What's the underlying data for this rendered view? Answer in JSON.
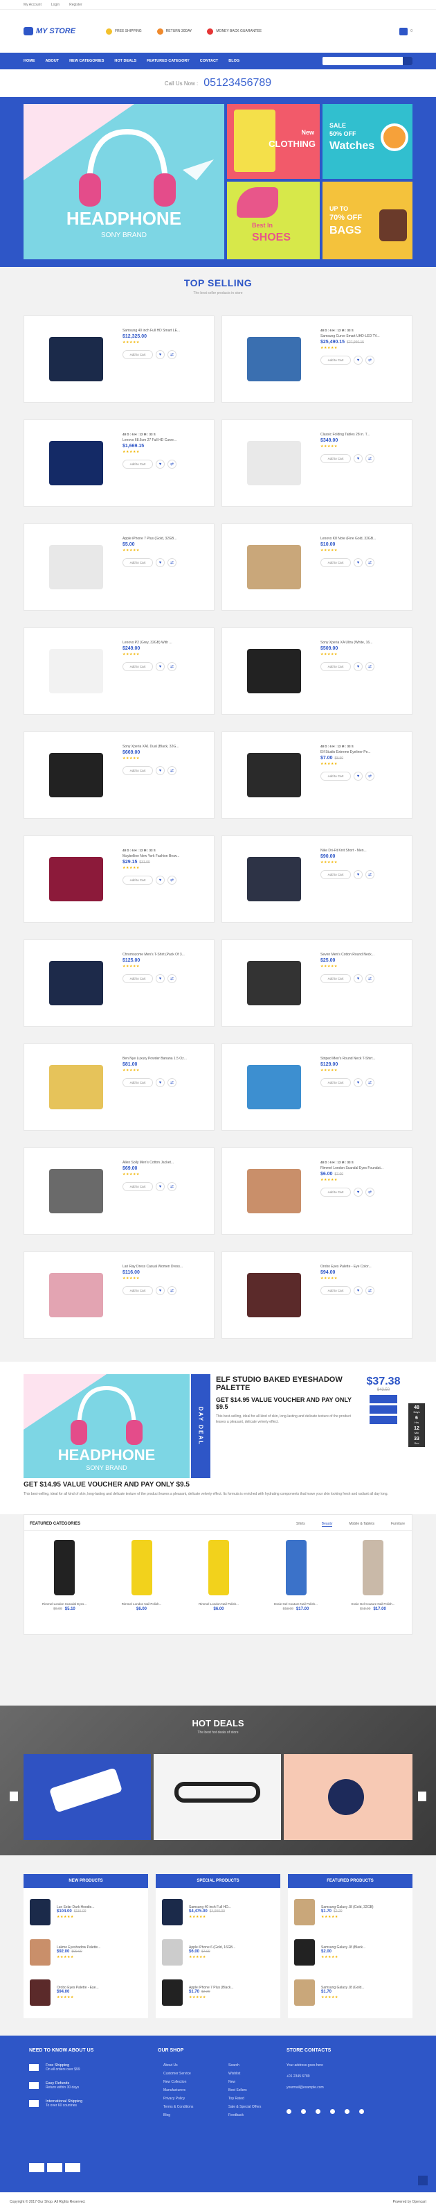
{
  "topbar": {
    "links": [
      "My Account",
      "Login",
      "Register"
    ]
  },
  "header": {
    "logo": "MY STORE",
    "features": [
      {
        "label": "FREE SHIPPING",
        "color": "#f3c12c"
      },
      {
        "label": "RETURN 30DAY",
        "color": "#f08a2c"
      },
      {
        "label": "MONEY BACK GUARANTEE",
        "color": "#e53535"
      }
    ],
    "cart_count": "0"
  },
  "nav": {
    "items": [
      "HOME",
      "ABOUT",
      "NEW CATEGORIES",
      "HOT DEALS",
      "FEATURED CATEGORY",
      "CONTACT",
      "BLOG"
    ],
    "search_placeholder": "Search entire store here..."
  },
  "callbar": {
    "label": "Call Us Now :",
    "number": "05123456789"
  },
  "hero": {
    "main_title": "HEADPHONE",
    "main_sub": "SONY BRAND",
    "tiles": [
      {
        "line1": "New",
        "line2": "CLOTHING"
      },
      {
        "line1": "SALE",
        "line2": "50% OFF",
        "line3": "Watches"
      },
      {
        "line1": "Best In",
        "line2": "SHOES"
      },
      {
        "line1": "UP TO",
        "line2": "70% OFF",
        "line3": "BAGS"
      }
    ]
  },
  "top_selling": {
    "title": "TOP SELLING",
    "subtitle": "The best seller products in store",
    "add_label": "Add to Cart",
    "products": [
      {
        "name": "Samsung 40 inch Full HD Smart LE...",
        "price": "$12,325.00",
        "old": "",
        "timer": "",
        "thumb": "tv-dark",
        "color": "#1b2a4a"
      },
      {
        "name": "Samsung Curve Smart UHD-LED TV...",
        "price": "$25,490.15",
        "old": "$27,990.15",
        "timer": "48 D : 6 H : 12 M : 33 S",
        "thumb": "tv-curve",
        "color": "#3a6fb0"
      },
      {
        "name": "Lenovo 68.6cm 27 Full HD Curve...",
        "price": "$1,669.15",
        "old": "",
        "timer": "48 D : 6 H : 12 M : 33 S",
        "thumb": "monitor",
        "color": "#142a66"
      },
      {
        "name": "Classic Folding Tables 28 in. T...",
        "price": "$349.00",
        "old": "",
        "timer": "",
        "thumb": "table",
        "color": "#e9e9e9"
      },
      {
        "name": "Apple iPhone 7 Plus (Gold, 32GB...",
        "price": "$5.00",
        "old": "",
        "timer": "",
        "thumb": "iphone",
        "color": "#e8e8e8"
      },
      {
        "name": "Lenovo K8 Note (Fine Gold, 32GB...",
        "price": "$10.00",
        "old": "",
        "timer": "",
        "thumb": "phone-gold",
        "color": "#c9a77a"
      },
      {
        "name": "Lenovo P2 (Grey, 32GB) With ...",
        "price": "$249.00",
        "old": "",
        "timer": "",
        "thumb": "phone-white",
        "color": "#f2f2f2"
      },
      {
        "name": "Sony Xperia XA Ultra (White, 16...",
        "price": "$509.00",
        "old": "",
        "timer": "",
        "thumb": "phone-black",
        "color": "#222"
      },
      {
        "name": "Sony Xperia XA1 Dual (Black, 32G...",
        "price": "$669.00",
        "old": "",
        "timer": "",
        "thumb": "phone-black2",
        "color": "#222"
      },
      {
        "name": "Elf Studio Extreme Eyeliner Pe...",
        "price": "$7.00",
        "old": "$8.50",
        "timer": "48 D : 6 H : 12 M : 33 S",
        "thumb": "pencil",
        "color": "#2a2a2a"
      },
      {
        "name": "Maybelline New York Fashion Brow...",
        "price": "$29.15",
        "old": "$31.00",
        "timer": "48 D : 6 H : 12 M : 33 S",
        "thumb": "mascara",
        "color": "#8c1a3a"
      },
      {
        "name": "Nike Dri-Fit Knit Short - Men...",
        "price": "$90.00",
        "old": "",
        "timer": "",
        "thumb": "shorts",
        "color": "#2d3346"
      },
      {
        "name": "Chromozome Men's T-Shirt (Pack Of 3...",
        "price": "$125.00",
        "old": "",
        "timer": "",
        "thumb": "tshirts",
        "color": "#1d2a4a"
      },
      {
        "name": "Seven Men's Cotton Round Neck...",
        "price": "$25.00",
        "old": "",
        "timer": "",
        "thumb": "tee",
        "color": "#333"
      },
      {
        "name": "Ben Nye Luxury Powder Banana 1.5 Oz...",
        "price": "$81.00",
        "old": "",
        "timer": "",
        "thumb": "powder",
        "color": "#e6c35a"
      },
      {
        "name": "Striped Men's Round Neck T-Shirt...",
        "price": "$129.00",
        "old": "",
        "timer": "",
        "thumb": "striped",
        "color": "#3d8fd0"
      },
      {
        "name": "Allen Solly Men's Cotton Jacket...",
        "price": "$69.00",
        "old": "",
        "timer": "",
        "thumb": "man",
        "color": "#6a6a6a"
      },
      {
        "name": "Rimmel London Scandal Eyes Foundat...",
        "price": "$6.00",
        "old": "$7.00",
        "timer": "48 D : 6 H : 12 M : 33 S",
        "thumb": "foundation",
        "color": "#c98f6a"
      },
      {
        "name": "Lari Ray Dress Casual Women Dress...",
        "price": "$116.00",
        "old": "",
        "timer": "",
        "thumb": "dress",
        "color": "#e3a4b2"
      },
      {
        "name": "Orobo Eyes Palette - Eye Color...",
        "price": "$94.00",
        "old": "",
        "timer": "",
        "thumb": "palette",
        "color": "#5b2a2a"
      }
    ]
  },
  "deal": {
    "banner_title": "HEADPHONE",
    "banner_sub": "SONY BRAND",
    "tag": "DAY DEAL",
    "title": "ELF STUDIO BAKED EYESHADOW PALETTE",
    "subtitle": "GET $14.95 VALUE VOUCHER AND PAY ONLY $9.5",
    "desc": "This best-selling, ideal for all kind of skin, long-lasting and delicate texture of the product leaves a pleasant, delicate velvety effect.",
    "headline": "GET $14.95 VALUE VOUCHER AND PAY ONLY $9.5",
    "paragraph": "This best-selling, ideal for all kind of skin, long-lasting and delicate texture of the product leaves a pleasant, delicate velvety effect. Its formula is enriched with hydrating components that leave your skin looking fresh and radiant all day long.",
    "price": "$37.38",
    "old": "$42.50",
    "count": [
      {
        "v": "48",
        "u": "Days"
      },
      {
        "v": "6",
        "u": "Hrs"
      },
      {
        "v": "12",
        "u": "Min"
      },
      {
        "v": "33",
        "u": "Sec"
      }
    ]
  },
  "featured": {
    "title": "FEATURED CATEGORIES",
    "tabs": [
      "Shirts",
      "Beauty",
      "Mobile & Tablets",
      "Furniture"
    ],
    "items": [
      {
        "name": "Rimmel London Scandal Eyes...",
        "price": "$5.10",
        "old": "$6.00",
        "color": "#222"
      },
      {
        "name": "Rimmel London Nail Polish...",
        "price": "$6.00",
        "old": "",
        "color": "#f2d21c"
      },
      {
        "name": "Rimmel London Nail Polish...",
        "price": "$6.00",
        "old": "",
        "color": "#f2d21c"
      },
      {
        "name": "Essie Gel Couture Nail Polish...",
        "price": "$17.00",
        "old": "$18.00",
        "color": "#3b72c9"
      },
      {
        "name": "Essie Gel Couture Nail Polish...",
        "price": "$17.00",
        "old": "$18.00",
        "color": "#c9b9a8"
      }
    ]
  },
  "hot": {
    "title": "HOT DEALS",
    "subtitle": "The best hot deals of store"
  },
  "lists": [
    {
      "title": "NEW PRODUCTS",
      "items": [
        {
          "name": "Lux Solar Dark Hoodie...",
          "price": "$104.00",
          "old": "$115.00",
          "color": "#1b2a4a"
        },
        {
          "name": "Lakme Eyeshadow Palette...",
          "price": "$92.00",
          "old": "$99.00",
          "color": "#c98f6a"
        },
        {
          "name": "Orobo Eyes Palette - Eye...",
          "price": "$94.00",
          "old": "",
          "color": "#5b2a2a"
        }
      ]
    },
    {
      "title": "SPECIAL PRODUCTS",
      "items": [
        {
          "name": "Samsung 40 inch Full HD...",
          "price": "$4,475.00",
          "old": "$4,990.00",
          "color": "#1b2a4a"
        },
        {
          "name": "Apple iPhone 6 (Gold, 16GB...",
          "price": "$6.00",
          "old": "$7.00",
          "color": "#ccc"
        },
        {
          "name": "Apple iPhone 7 Plus (Black...",
          "price": "$1.70",
          "old": "$2.20",
          "color": "#222"
        }
      ]
    },
    {
      "title": "FEATURED PRODUCTS",
      "items": [
        {
          "name": "Samsung Galaxy J8 (Gold, 32GB)",
          "price": "$1.70",
          "old": "$2.20",
          "color": "#c9a77a"
        },
        {
          "name": "Samsung Galaxy J8 (Black...",
          "price": "$2.00",
          "old": "",
          "color": "#222"
        },
        {
          "name": "Samsung Galaxy J8 (Gold...",
          "price": "$1.70",
          "old": "",
          "color": "#c9a77a"
        }
      ]
    }
  ],
  "footer": {
    "col1": {
      "title": "NEED TO KNOW ABOUT US",
      "items": [
        {
          "t": "Free Shipping",
          "s": "On all orders over $99"
        },
        {
          "t": "Easy Refunds",
          "s": "Return within 30 days"
        },
        {
          "t": "International Shipping",
          "s": "To over 60 countries"
        }
      ]
    },
    "col2": {
      "title": "OUR SHOP",
      "left": [
        "About Us",
        "Customer Service",
        "New Collection",
        "Manufacturers",
        "Privacy Policy",
        "Terms & Conditions",
        "Blog"
      ],
      "right": [
        "Search",
        "Wishlist",
        "New",
        "Best Sellers",
        "Top Rated",
        "Sale & Special Offers",
        "Feedback"
      ]
    },
    "col3": {
      "title": "STORE CONTACTS",
      "items": [
        "Your address goes here",
        "+01 2345 6789",
        "yourmail@example.com"
      ]
    },
    "copyright": "Copyright © 2017 Our Shop. All Rights Reserved.",
    "powered": "Powered by Opencart"
  }
}
